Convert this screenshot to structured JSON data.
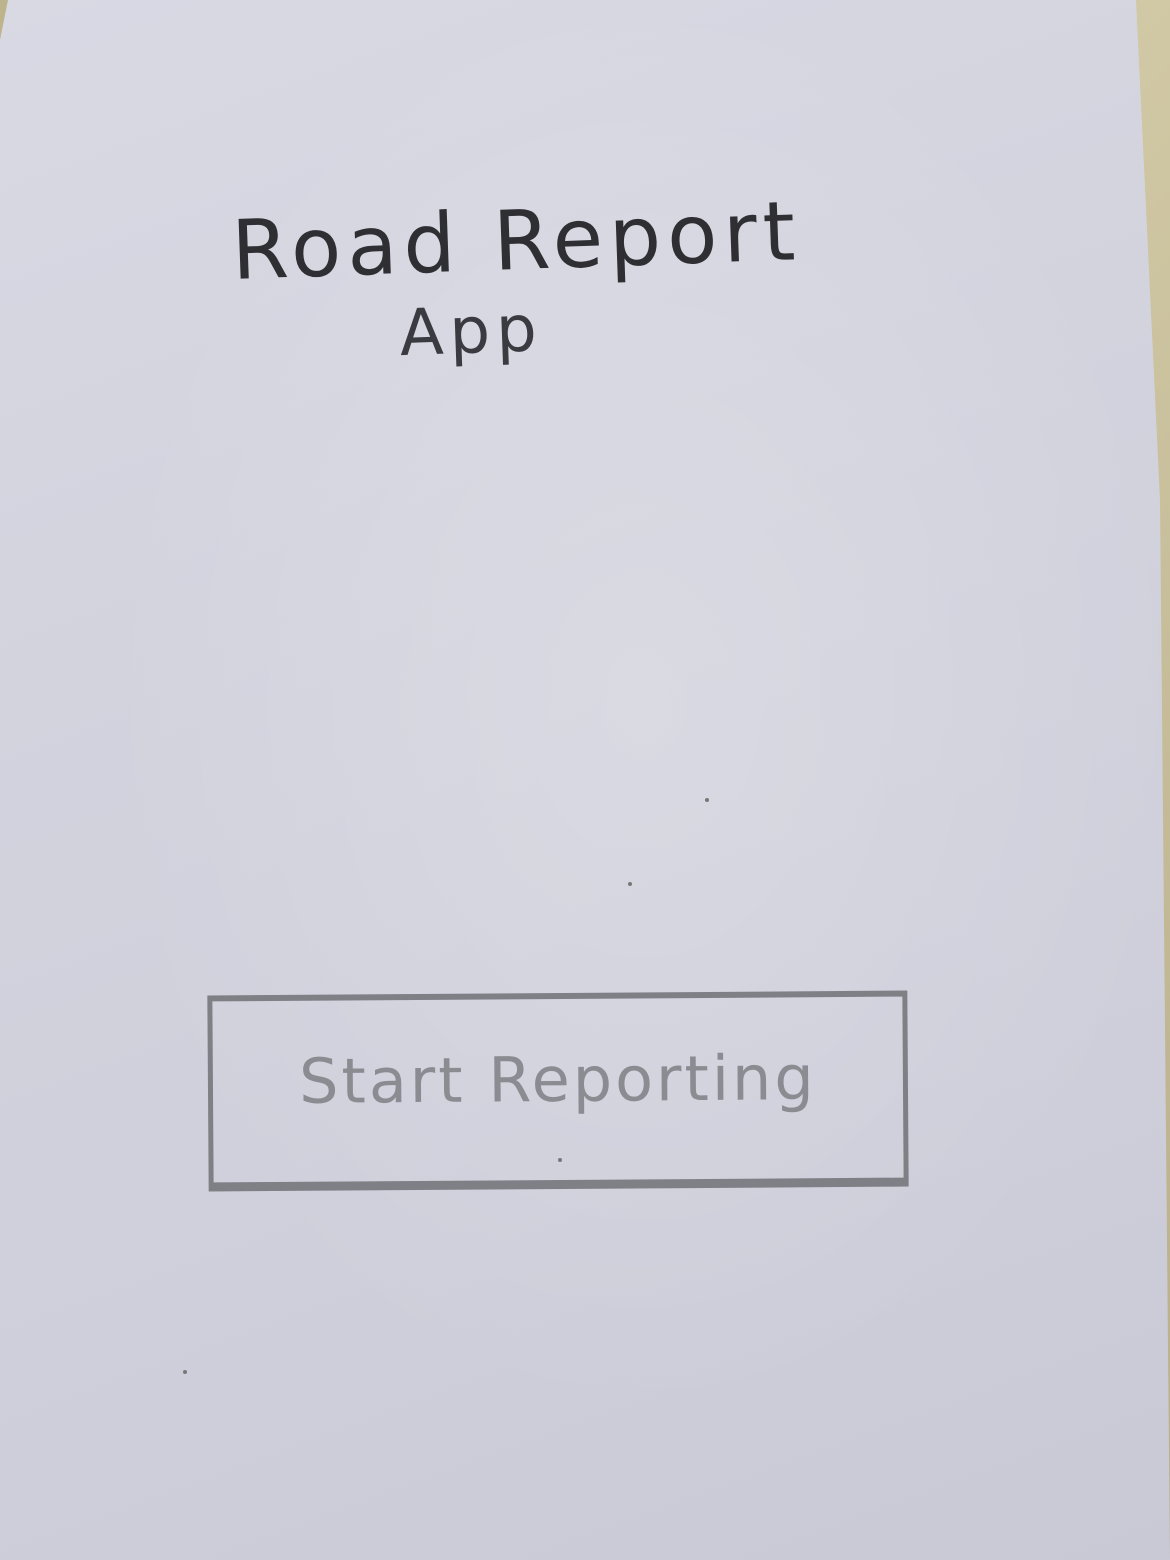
{
  "screen": {
    "title_line1": "Road Report",
    "title_line2": "App"
  },
  "actions": {
    "start_label": "Start Reporting"
  },
  "colors": {
    "paper": "#d3d3de",
    "ink": "#2e2e33",
    "pencil_light": "#8b8b92",
    "background": "#c9bf9a"
  }
}
